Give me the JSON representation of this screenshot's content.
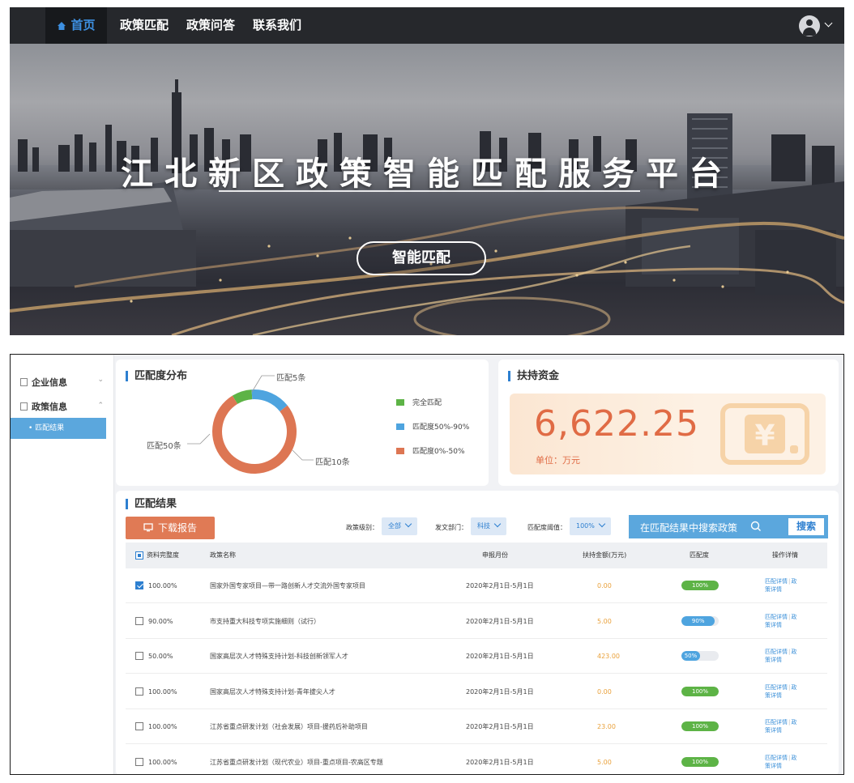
{
  "nav": {
    "home": "首页",
    "items": [
      "政策匹配",
      "政策问答",
      "联系我们"
    ]
  },
  "banner": {
    "title": "江北新区政策智能匹配服务平台",
    "button": "智能匹配"
  },
  "sidebar": {
    "items": [
      {
        "label": "企业信息",
        "chevron": "⌄"
      },
      {
        "label": "政策信息",
        "chevron": "⌃"
      }
    ],
    "active_sub": "• 匹配结果"
  },
  "distribution": {
    "title": "匹配度分布",
    "labels": [
      "匹配5条",
      "匹配50条",
      "匹配10条"
    ],
    "legend": [
      {
        "label": "完全匹配",
        "color": "#5db346"
      },
      {
        "label": "匹配度50%-90%",
        "color": "#4ea4df"
      },
      {
        "label": "匹配度0%-50%",
        "color": "#dd7653"
      }
    ]
  },
  "chart_data": {
    "type": "pie",
    "title": "匹配度分布",
    "series": [
      {
        "name": "完全匹配",
        "value": 5
      },
      {
        "name": "匹配度50%-90%",
        "value": 10
      },
      {
        "name": "匹配度0%-50%",
        "value": 50
      }
    ]
  },
  "fund": {
    "title": "扶持资金",
    "value": "6,622.25",
    "unit": "单位：万元",
    "icon": "yen-icon"
  },
  "results": {
    "title": "匹配结果",
    "download": "下载报告",
    "filters": [
      {
        "label": "政策级别：",
        "value": "全部"
      },
      {
        "label": "发文部门：",
        "value": "科技"
      },
      {
        "label": "匹配度阈值：",
        "value": "100%"
      }
    ],
    "search_placeholder": "在匹配结果中搜索政策",
    "search_button": "搜索",
    "headers": [
      "资料完整度",
      "政策名称",
      "申报月份",
      "扶持金额(万元)",
      "匹配度",
      "操作详情"
    ],
    "rows": [
      {
        "checked": true,
        "completeness": "100.00%",
        "name": "国家外国专家项目—带一路创新人才交流外国专家项目",
        "month": "2020年2月1日-5月1日",
        "amount": "0.00",
        "match": 100,
        "match_label": "100%",
        "link1": "匹配详情",
        "link2": "政策详情"
      },
      {
        "checked": false,
        "completeness": "90.00%",
        "name": "市支持重大科技专项实施细则（试行）",
        "month": "2020年2月1日-5月1日",
        "amount": "5.00",
        "match": 90,
        "match_label": "90%",
        "link1": "匹配详情",
        "link2": "政策详情"
      },
      {
        "checked": false,
        "completeness": "50.00%",
        "name": "国家高层次人才特殊支持计划-科技创新领军人才",
        "month": "2020年2月1日-5月1日",
        "amount": "423.00",
        "match": 50,
        "match_label": "50%",
        "link1": "匹配详情",
        "link2": "政策详情"
      },
      {
        "checked": false,
        "completeness": "100.00%",
        "name": "国家高层次人才特殊支持计划-青年拔尖人才",
        "month": "2020年2月1日-5月1日",
        "amount": "0.00",
        "match": 100,
        "match_label": "100%",
        "link1": "匹配详情",
        "link2": "政策详情"
      },
      {
        "checked": false,
        "completeness": "100.00%",
        "name": "江苏省重点研发计划（社会发展）项目-援药后补助项目",
        "month": "2020年2月1日-5月1日",
        "amount": "23.00",
        "match": 100,
        "match_label": "100%",
        "link1": "匹配详情",
        "link2": "政策详情"
      },
      {
        "checked": false,
        "completeness": "100.00%",
        "name": "江苏省重点研发计划（现代农业）项目-重点项目-农高区专题",
        "month": "2020年2月1日-5月1日",
        "amount": "5.00",
        "match": 100,
        "match_label": "100%",
        "link1": "匹配详情",
        "link2": "政策详情"
      }
    ]
  },
  "colors": {
    "accent": "#2d7fd0",
    "full_match": "#5db346",
    "mid_match": "#4ea4df",
    "low_match": "#dd7653",
    "fund": "#e06b45"
  }
}
